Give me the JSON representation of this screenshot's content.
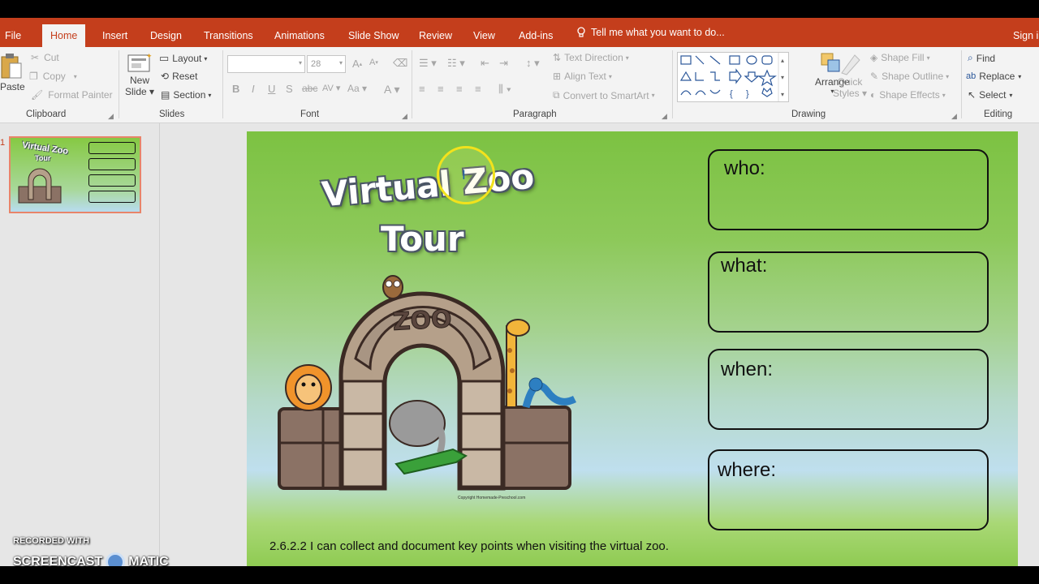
{
  "tabs": {
    "file": "File",
    "home": "Home",
    "insert": "Insert",
    "design": "Design",
    "transitions": "Transitions",
    "animations": "Animations",
    "slide_show": "Slide Show",
    "review": "Review",
    "view": "View",
    "addins": "Add-ins",
    "tell_me": "Tell me what you want to do...",
    "sign_in": "Sign in"
  },
  "clipboard": {
    "paste": "Paste",
    "cut": "Cut",
    "copy": "Copy",
    "format_painter": "Format Painter",
    "group_label": "Clipboard"
  },
  "slides_group": {
    "new_slide_1": "New",
    "new_slide_2": "Slide",
    "layout": "Layout",
    "reset": "Reset",
    "section": "Section",
    "group_label": "Slides"
  },
  "font": {
    "font_name": "",
    "font_size": "28",
    "group_label": "Font"
  },
  "paragraph": {
    "text_direction": "Text Direction",
    "align_text": "Align Text",
    "convert_smartart": "Convert to SmartArt",
    "group_label": "Paragraph"
  },
  "drawing": {
    "arrange": "Arrange",
    "quick_styles_1": "Quick",
    "quick_styles_2": "Styles",
    "shape_fill": "Shape Fill",
    "shape_outline": "Shape Outline",
    "shape_effects": "Shape Effects",
    "group_label": "Drawing"
  },
  "editing": {
    "find": "Find",
    "replace": "Replace",
    "select": "Select",
    "group_label": "Editing"
  },
  "thumbnail": {
    "number": "1",
    "title_1": "Virtual Zoo",
    "title_2": "Tour"
  },
  "slide": {
    "title_line1": "Virtual Zoo",
    "title_line2": "Tour",
    "zoo_sign": "ZOO",
    "copyright": "Copyright Homemade-Preschool.com",
    "questions": [
      "who:",
      "what:",
      "when:",
      "where:"
    ],
    "objective": "2.6.2.2 I can collect and document key points when visiting the virtual  zoo."
  },
  "watermark": {
    "line1": "RECORDED WITH",
    "line2_a": "SCREENCAST",
    "line2_b": "MATIC"
  },
  "colors": {
    "ribbon_accent": "#c43e1c",
    "slide_green": "#7cc242",
    "cursor_highlight": "#f2e21c"
  }
}
